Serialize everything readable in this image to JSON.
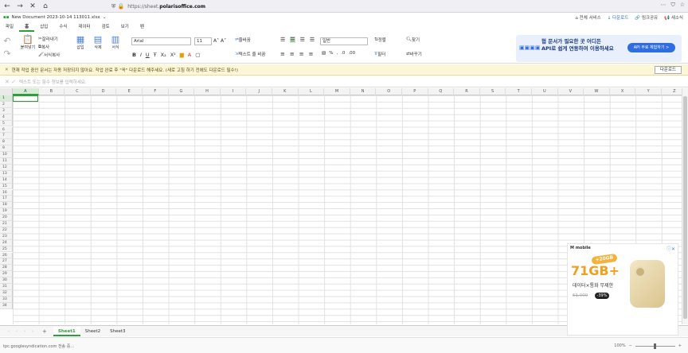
{
  "browser": {
    "url_prefix": "https://sheet.",
    "url_domain": "polarisoffice.com",
    "nav": {
      "back": "←",
      "forward": "→",
      "close": "✕",
      "home": "⌂"
    },
    "right_icons": [
      "⋯",
      "⛉",
      "☆"
    ]
  },
  "titlebar": {
    "doc_icon": "▪▪",
    "doc_title": "New Document 2023-10-14 113011.xlsx",
    "dropdown": "⌄",
    "links": [
      "전체 서비스",
      "다운로드",
      "링크공유",
      "새소식"
    ]
  },
  "menubar": {
    "items": [
      "파일",
      "홈",
      "삽입",
      "수식",
      "데이터",
      "검토",
      "보기",
      "펜"
    ],
    "active_index": 1
  },
  "ribbon": {
    "paste_label": "붙여넣기",
    "cut_label": "잘라내기",
    "copy_label": "복사",
    "format_copy_label": "서식복사",
    "insert_label": "삽입",
    "delete_label": "삭제",
    "format_label": "서식",
    "font_name": "Arial",
    "font_size": "11",
    "format_value": "일반",
    "wrap_label": "줄바꿈",
    "text_dir_label": "텍스트 줄 비꿈",
    "sort_label": "정렬",
    "find_label": "찾기",
    "filter_label": "필터",
    "replace_label": "바꾸기",
    "bold": "B",
    "italic": "I",
    "underline": "U",
    "strike": "Ŧ"
  },
  "promo": {
    "line1": "협 문서가 필요한 곳 어디든",
    "line2": "API로 쉽게 연동하여 이용하세요",
    "button": "API 무료 체험하기 >"
  },
  "notice": {
    "close": "✕",
    "text": "현재 작업 중인 문서는 자동 저장되지 않아요. 작업 완료 후 \"꼭\" 다운로드 해주세요. (새로 고침 하기 전에도 다운로드 필수!)",
    "download": "다운로드"
  },
  "formulabar": {
    "placeholder": "텍스트 또는 함수 정보를 입력하세요."
  },
  "grid": {
    "columns": [
      "A",
      "B",
      "C",
      "D",
      "E",
      "F",
      "G",
      "H",
      "I",
      "J",
      "K",
      "L",
      "M",
      "N",
      "O",
      "P",
      "Q",
      "R",
      "S",
      "T",
      "U",
      "V",
      "W",
      "X",
      "Y",
      "Z"
    ],
    "rows": [
      "1",
      "2",
      "3",
      "4",
      "5",
      "6",
      "7",
      "8",
      "9",
      "10",
      "11",
      "12",
      "13",
      "14",
      "15",
      "16",
      "17",
      "18",
      "19",
      "20",
      "21",
      "22",
      "23",
      "24",
      "25",
      "26",
      "27",
      "28",
      "29",
      "30",
      "31",
      "32",
      "33",
      "34"
    ],
    "selected_cell": "A1"
  },
  "sheets": {
    "tabs": [
      "Sheet1",
      "Sheet2",
      "Sheet3"
    ],
    "active_index": 0,
    "nav": "‹ ‹ › ›",
    "add": "+"
  },
  "status": {
    "text": "tpc.googlesyndication.com 전송 중...",
    "zoom": "100%",
    "minus": "−",
    "plus": "+"
  },
  "ad": {
    "brand": "M mobile",
    "badge": "+20GB",
    "headline": "71GB+",
    "sub": "데이터×통화 무제한",
    "old_price": "51,000",
    "discount": "-39%"
  }
}
